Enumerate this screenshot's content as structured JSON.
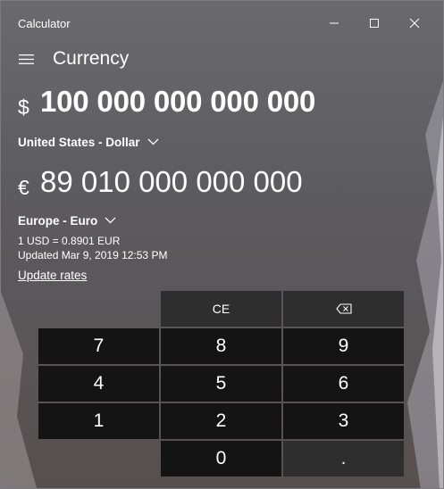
{
  "window": {
    "title": "Calculator",
    "controls": {
      "minimize_icon": "minimize-icon",
      "maximize_icon": "maximize-icon",
      "close_icon": "close-icon"
    }
  },
  "header": {
    "menu_icon": "hamburger-menu-icon",
    "mode": "Currency"
  },
  "from": {
    "symbol": "$",
    "value": "100 000 000 000 000",
    "unit": "United States - Dollar"
  },
  "to": {
    "symbol": "€",
    "value": "89 010 000 000 000",
    "unit": "Europe - Euro"
  },
  "rate": {
    "text": "1 USD = 0.8901 EUR",
    "updated": "Updated Mar 9, 2019 12:53 PM",
    "update_link": "Update rates"
  },
  "keypad": {
    "ce": "CE",
    "backspace_icon": "backspace-icon",
    "digits": {
      "d7": "7",
      "d8": "8",
      "d9": "9",
      "d4": "4",
      "d5": "5",
      "d6": "6",
      "d1": "1",
      "d2": "2",
      "d3": "3",
      "d0": "0"
    },
    "decimal": "."
  },
  "colors": {
    "digit_key": "#141414",
    "function_key": "#2e2e2e",
    "text": "#ffffff"
  }
}
